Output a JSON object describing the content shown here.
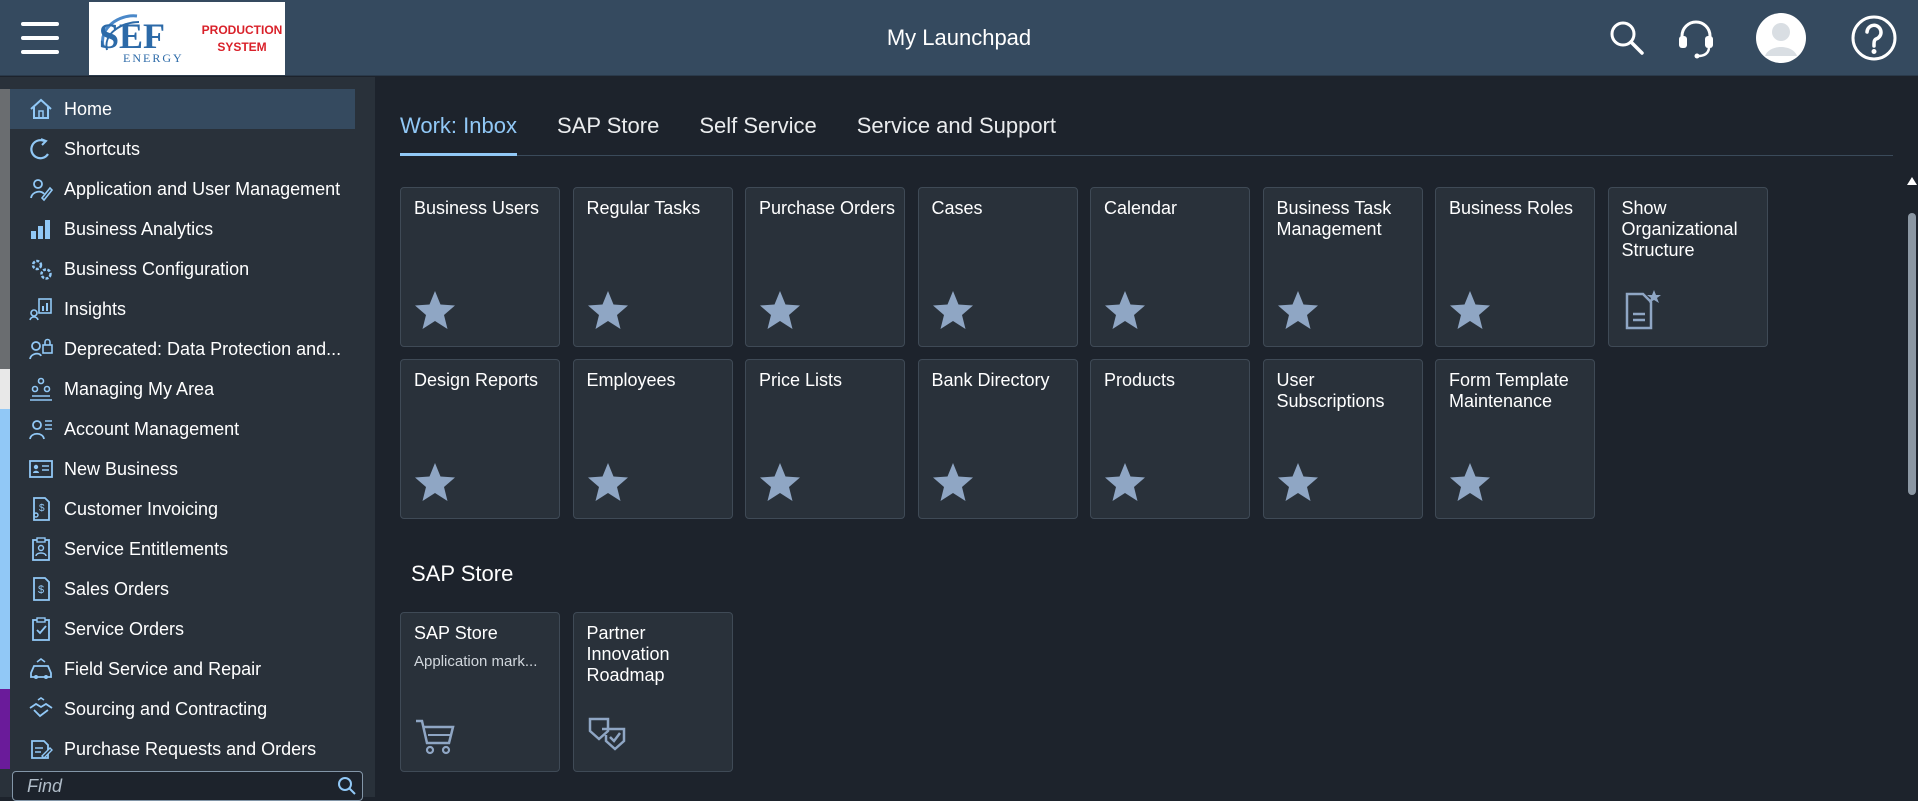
{
  "shell": {
    "title": "My Launchpad",
    "logo_text_line1": "PRODUCTION",
    "logo_text_line2": "SYSTEM",
    "logo_wordmark": "SEF ENERGY"
  },
  "sidebar": {
    "accent_colors": [
      "#6a6d70",
      "#6a6d70",
      "#6a6d70",
      "#6a6d70",
      "#6a6d70",
      "#6a6d70",
      "#6a6d70",
      "#e8e8e8",
      "#91c8f6",
      "#91c8f6",
      "#91c8f6",
      "#91c8f6",
      "#91c8f6",
      "#91c8f6",
      "#91c8f6",
      "#6a1b9a",
      "#6a1b9a"
    ],
    "items": [
      {
        "label": "Home",
        "icon": "home-icon"
      },
      {
        "label": "Shortcuts",
        "icon": "shortcut-icon"
      },
      {
        "label": "Application and User Management",
        "icon": "user-edit-icon"
      },
      {
        "label": "Business Analytics",
        "icon": "bar-chart-icon"
      },
      {
        "label": "Business Configuration",
        "icon": "gears-icon"
      },
      {
        "label": "Insights",
        "icon": "insights-icon"
      },
      {
        "label": "Deprecated: Data Protection and...",
        "icon": "user-lock-icon"
      },
      {
        "label": "Managing My Area",
        "icon": "org-icon"
      },
      {
        "label": "Account Management",
        "icon": "account-icon"
      },
      {
        "label": "New Business",
        "icon": "business-card-icon"
      },
      {
        "label": "Customer Invoicing",
        "icon": "invoice-icon"
      },
      {
        "label": "Service Entitlements",
        "icon": "clipboard-user-icon"
      },
      {
        "label": "Sales Orders",
        "icon": "sales-order-icon"
      },
      {
        "label": "Service Orders",
        "icon": "clipboard-check-icon"
      },
      {
        "label": "Field Service and Repair",
        "icon": "car-service-icon"
      },
      {
        "label": "Sourcing and Contracting",
        "icon": "handshake-icon"
      },
      {
        "label": "Purchase Requests and Orders",
        "icon": "purchase-icon"
      }
    ],
    "find_placeholder": "Find"
  },
  "tabs": [
    {
      "label": "Work: Inbox",
      "active": true
    },
    {
      "label": "SAP Store",
      "active": false
    },
    {
      "label": "Self Service",
      "active": false
    },
    {
      "label": "Service and Support",
      "active": false
    }
  ],
  "tiles_row1": [
    {
      "title": "Business Users",
      "icon": "star-icon"
    },
    {
      "title": "Regular Tasks",
      "icon": "star-icon"
    },
    {
      "title": "Purchase Orders",
      "icon": "star-icon"
    },
    {
      "title": "Cases",
      "icon": "star-icon"
    },
    {
      "title": "Calendar",
      "icon": "star-icon"
    },
    {
      "title": "Business Task Management",
      "icon": "star-icon"
    },
    {
      "title": "Business Roles",
      "icon": "star-icon"
    },
    {
      "title": "Show Organizational Structure",
      "icon": "document-star-icon"
    }
  ],
  "tiles_row2": [
    {
      "title": "Design Reports",
      "icon": "star-icon"
    },
    {
      "title": "Employees",
      "icon": "star-icon"
    },
    {
      "title": "Price Lists",
      "icon": "star-icon"
    },
    {
      "title": "Bank Directory",
      "icon": "star-icon"
    },
    {
      "title": "Products",
      "icon": "star-icon"
    },
    {
      "title": "User Subscriptions",
      "icon": "star-icon"
    },
    {
      "title": "Form Template Maintenance",
      "icon": "star-icon"
    }
  ],
  "sap_store_section": {
    "title": "SAP Store",
    "tiles": [
      {
        "title": "SAP Store",
        "subtitle": "Application mark...",
        "icon": "cart-icon"
      },
      {
        "title": "Partner Innovation Roadmap",
        "subtitle": "",
        "icon": "roadmap-icon"
      }
    ]
  },
  "colors": {
    "shell": "#354a5f",
    "background": "#1d232c",
    "tile": "#29313a",
    "accent": "#91c8f6",
    "icon": "#91a8c3"
  }
}
